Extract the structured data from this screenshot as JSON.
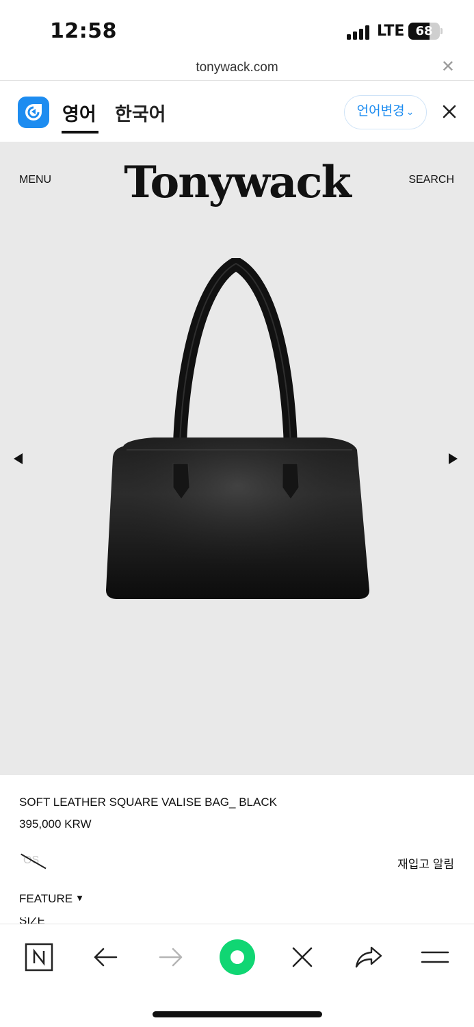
{
  "status_bar": {
    "time": "12:58",
    "network": "LTE",
    "battery": "68",
    "battery_level": 0.68
  },
  "browser": {
    "url": "tonywack.com"
  },
  "translator": {
    "tab_english": "영어",
    "tab_korean": "한국어",
    "change_language": "언어변경",
    "accent_color": "#1d8cf0"
  },
  "site": {
    "menu": "MENU",
    "logo": "Tonywack",
    "search": "SEARCH",
    "hero_background": "#e9e9e9"
  },
  "product": {
    "title": "SOFT LEATHER SQUARE VALISE BAG_ BLACK",
    "price": "395,000 KRW",
    "os_badge": "OS",
    "restock_alert": "재입고 알림",
    "feature": "FEATURE",
    "feature_caret": "▼",
    "size": "SIZE"
  },
  "toolbar": {
    "icons": [
      "n-home-icon",
      "back-arrow-icon",
      "forward-arrow-icon",
      "green-dot-icon",
      "close-icon",
      "share-icon",
      "menu-icon"
    ],
    "green_color": "#10d673"
  }
}
